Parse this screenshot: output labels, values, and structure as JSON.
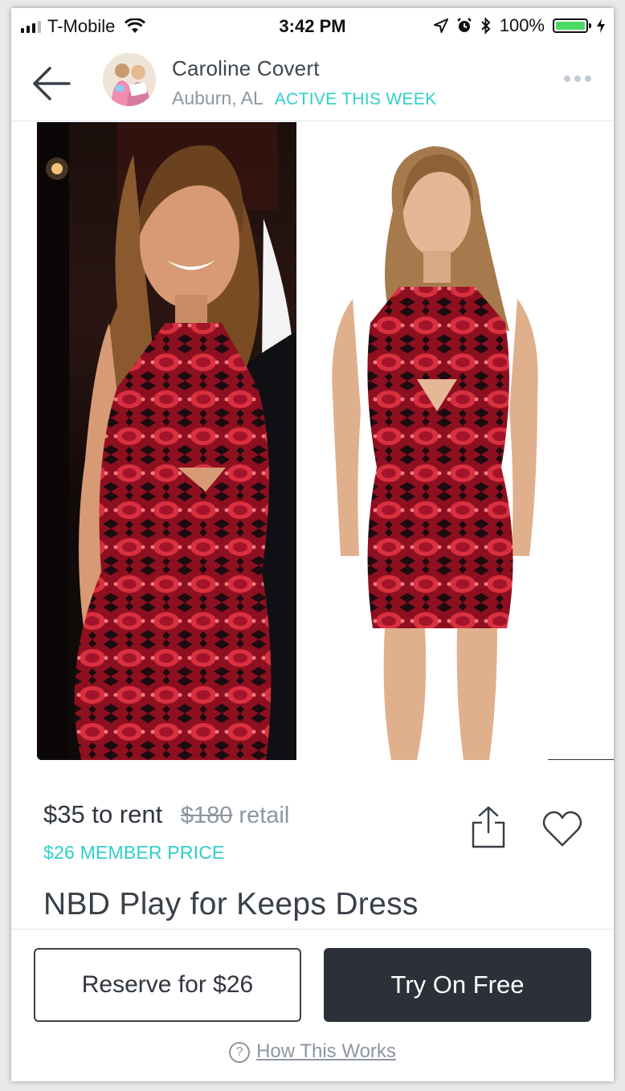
{
  "status_bar": {
    "carrier": "T-Mobile",
    "time": "3:42 PM",
    "battery": "100%",
    "battery_level": 1.0
  },
  "header": {
    "seller_name": "Caroline Covert",
    "location": "Auburn, AL",
    "activity": "ACTIVE THIS WEEK"
  },
  "listing": {
    "rent_price": "$35 to rent",
    "retail_price": "$180",
    "retail_label": "retail",
    "member_price": "$26 MEMBER PRICE",
    "title": "NBD Play for Keeps Dress"
  },
  "actions": {
    "reserve_label": "Reserve for $26",
    "try_on_label": "Try On Free",
    "help_icon_glyph": "?",
    "help_link": "How This Works"
  },
  "colors": {
    "accent": "#2fcfca",
    "dark_button": "#2c3038",
    "dress_red": "#b8182a"
  },
  "icons": [
    "signal-icon",
    "wifi-icon",
    "location-arrow-icon",
    "alarm-icon",
    "bluetooth-icon",
    "battery-icon",
    "charging-icon",
    "back-arrow-icon",
    "more-icon",
    "share-icon",
    "heart-icon",
    "question-icon"
  ]
}
